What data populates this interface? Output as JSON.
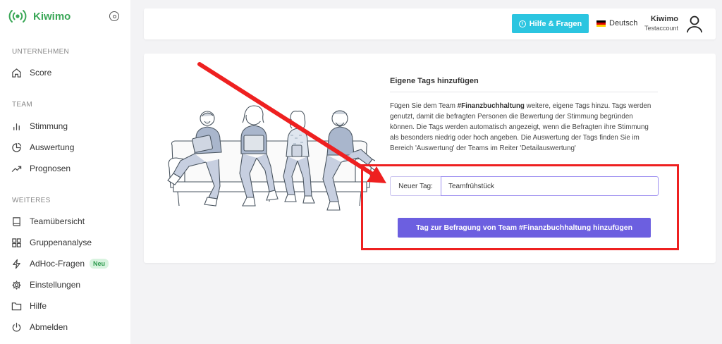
{
  "app": {
    "name": "Kiwimo",
    "brand_color": "#3aa757"
  },
  "sidebar": {
    "sections": [
      {
        "label": "UNTERNEHMEN"
      },
      {
        "label": "TEAM"
      },
      {
        "label": "WEITERES"
      }
    ],
    "items": [
      {
        "label": "Score",
        "icon": "home-icon"
      },
      {
        "label": "Stimmung",
        "icon": "bar-chart-icon"
      },
      {
        "label": "Auswertung",
        "icon": "pie-chart-icon"
      },
      {
        "label": "Prognosen",
        "icon": "trending-up-icon"
      },
      {
        "label": "Teamübersicht",
        "icon": "book-icon"
      },
      {
        "label": "Gruppenanalyse",
        "icon": "grid-icon"
      },
      {
        "label": "AdHoc-Fragen",
        "icon": "lightning-icon",
        "badge": "Neu"
      },
      {
        "label": "Einstellungen",
        "icon": "gear-icon"
      },
      {
        "label": "Hilfe",
        "icon": "folder-icon"
      },
      {
        "label": "Abmelden",
        "icon": "power-icon"
      }
    ]
  },
  "header": {
    "help_label": "Hilfe & Fragen",
    "help_color": "#2bc5e0",
    "language": "Deutsch",
    "user_name": "Kiwimo",
    "user_sub": "Testaccount"
  },
  "form": {
    "title": "Eigene Tags hinzufügen",
    "desc_pre": "Fügen Sie dem Team ",
    "desc_team": "#Finanzbuchhaltung",
    "desc_post": " weitere, eigene Tags hinzu. Tags werden genutzt, damit die befragten Personen die Bewertung der Stimmung begründen können. Die Tags werden automatisch angezeigt, wenn die Befragten ihre Stimmung als besonders niedrig oder hoch angeben. Die Auswertung der Tags finden Sie im Bereich 'Auswertung' der Teams im Reiter 'Detailauswertung'",
    "input_label": "Neuer Tag:",
    "input_value": "Teamfrühstück",
    "submit_label": "Tag zur Befragung von Team #Finanzbuchhaltung hinzufügen",
    "submit_color": "#6c5fe0"
  },
  "annotation": {
    "color": "#ee2020"
  }
}
